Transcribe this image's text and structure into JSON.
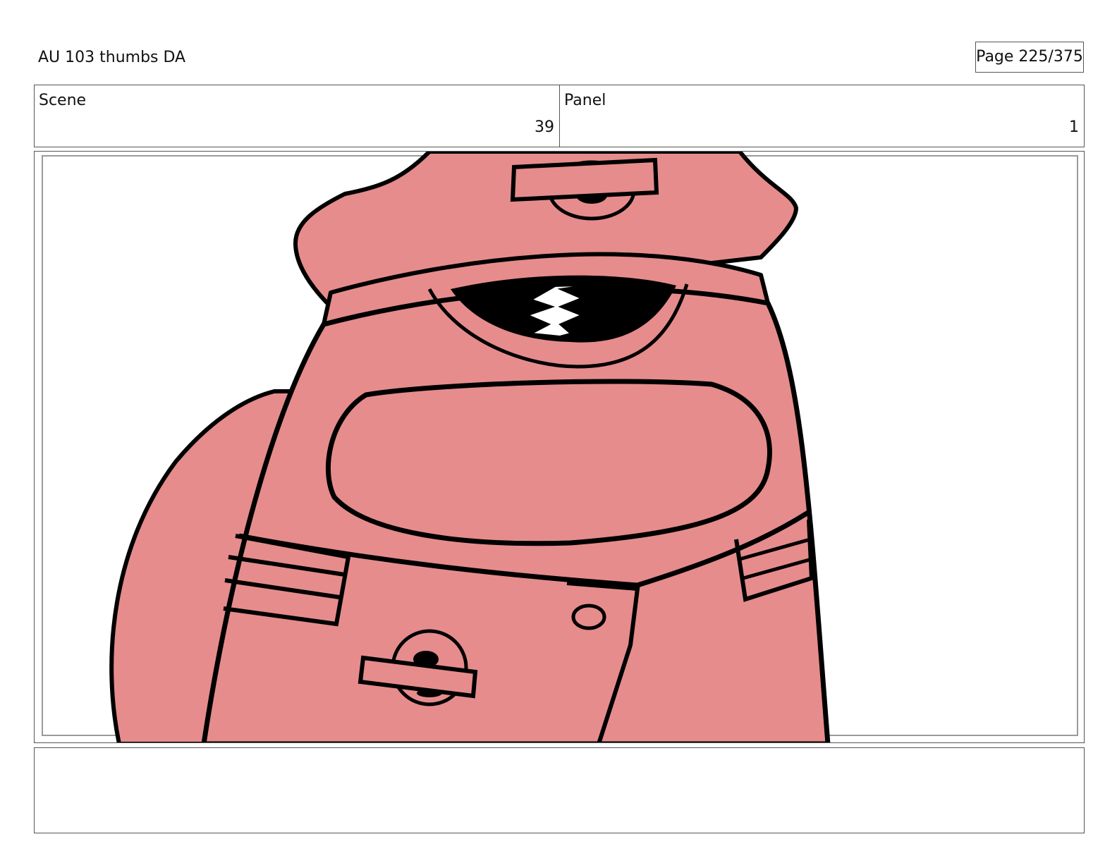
{
  "header": {
    "title": "AU 103 thumbs DA",
    "page_indicator": "Page 225/375"
  },
  "info": {
    "scene_label": "Scene",
    "scene_value": "39",
    "panel_label": "Panel",
    "panel_value": "1"
  },
  "artwork": {
    "subject": "robot-character-closeup",
    "fill_color": "#E68C8C",
    "line_color": "#000000"
  },
  "notes": {
    "text": ""
  }
}
